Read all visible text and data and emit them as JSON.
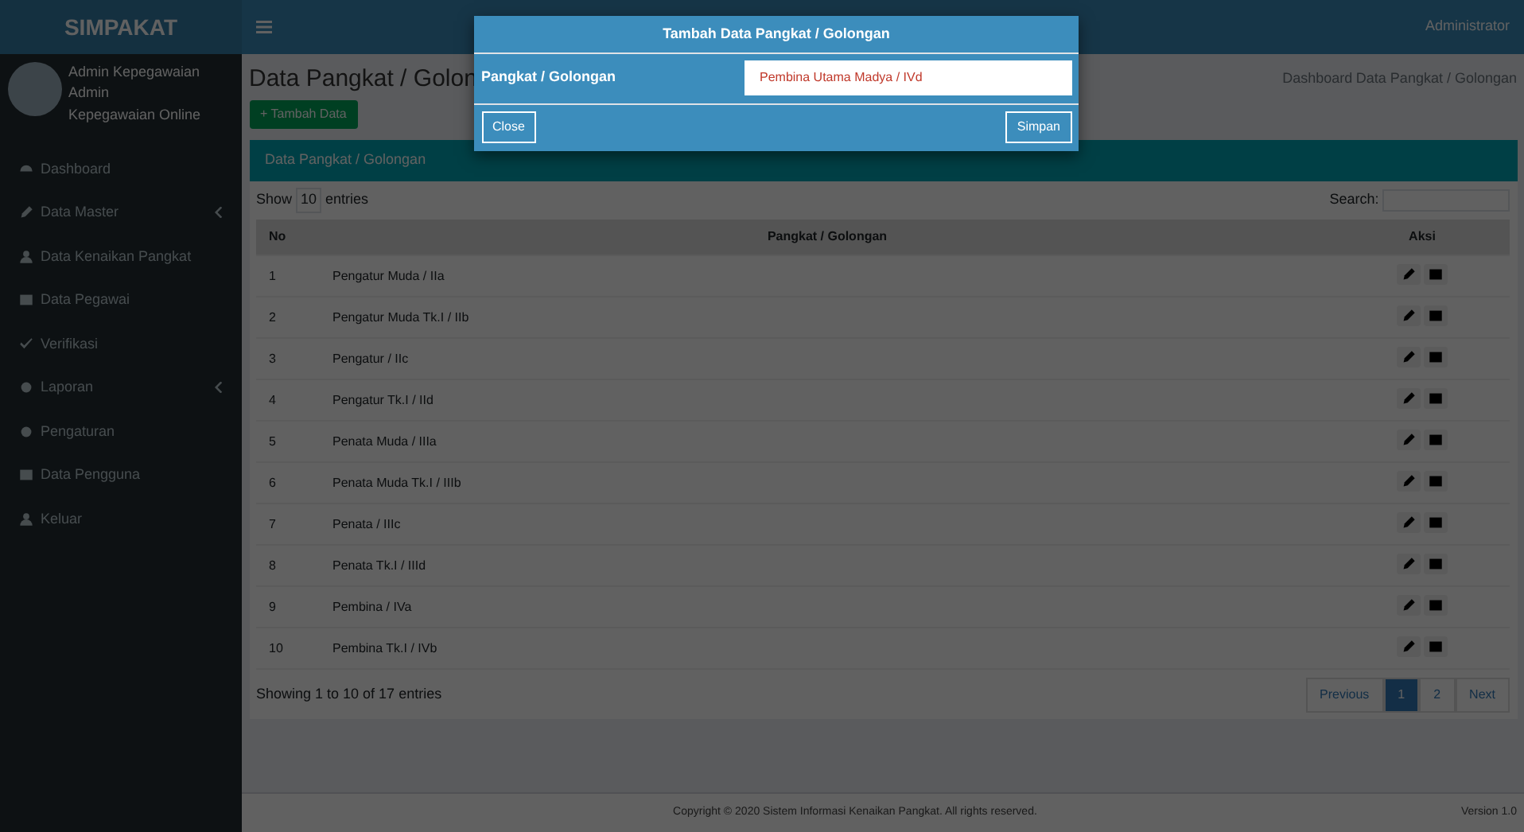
{
  "brand": "SIMPAKAT",
  "user": {
    "name": "Admin Kepegawaian",
    "role": "Admin",
    "status": "Kepegawaian Online"
  },
  "topbar": {
    "account": "Administrator"
  },
  "sidebar": {
    "items": [
      {
        "label": "Dashboard",
        "caret": false
      },
      {
        "label": "Data Master",
        "caret": true
      },
      {
        "label": "Data Kenaikan Pangkat",
        "caret": false
      },
      {
        "label": "Data Pegawai",
        "caret": false
      },
      {
        "label": "Verifikasi",
        "caret": false
      },
      {
        "label": "Laporan",
        "caret": true
      },
      {
        "label": "Pengaturan",
        "caret": false
      },
      {
        "label": "Data Pengguna",
        "caret": false
      },
      {
        "label": "Keluar",
        "caret": false
      }
    ]
  },
  "page": {
    "title": "Data Pangkat / Golon",
    "breadcrumb": [
      "Dashboard",
      "Data Pangkat / Golongan"
    ],
    "add_button": "+ Tambah Data",
    "box_title": "Data Pangkat / Golongan"
  },
  "table": {
    "length_label": "Show",
    "length_value": "10",
    "length_suffix": "entries",
    "search_label": "Search:",
    "columns": [
      "No",
      "Pangkat / Golongan",
      "Aksi"
    ],
    "rows": [
      {
        "no": "1",
        "name": "Pengatur Muda / IIa"
      },
      {
        "no": "2",
        "name": "Pengatur Muda Tk.I / IIb"
      },
      {
        "no": "3",
        "name": "Pengatur / IIc"
      },
      {
        "no": "4",
        "name": "Pengatur Tk.I / IId"
      },
      {
        "no": "5",
        "name": "Penata Muda / IIIa"
      },
      {
        "no": "6",
        "name": "Penata Muda Tk.I / IIIb"
      },
      {
        "no": "7",
        "name": "Penata / IIIc"
      },
      {
        "no": "8",
        "name": "Penata Tk.I / IIId"
      },
      {
        "no": "9",
        "name": "Pembina / IVa"
      },
      {
        "no": "10",
        "name": "Pembina Tk.I / IVb"
      }
    ],
    "info": "Showing 1 to 10 of 17 entries",
    "pages": [
      {
        "label": "Previous",
        "selected": false
      },
      {
        "label": "1",
        "selected": true
      },
      {
        "label": "2",
        "selected": false
      },
      {
        "label": "Next",
        "selected": false
      }
    ]
  },
  "footer": {
    "copyright": "Copyright © 2020 Sistem Informasi Kenaikan Pangkat. All rights reserved.",
    "version": "Version 1.0"
  },
  "modal": {
    "title": "Tambah Data Pangkat / Golongan",
    "label": "Pangkat / Golongan",
    "placeholder": "Pembina Utama Madya / IVd",
    "close": "Close",
    "save": "Simpan"
  }
}
